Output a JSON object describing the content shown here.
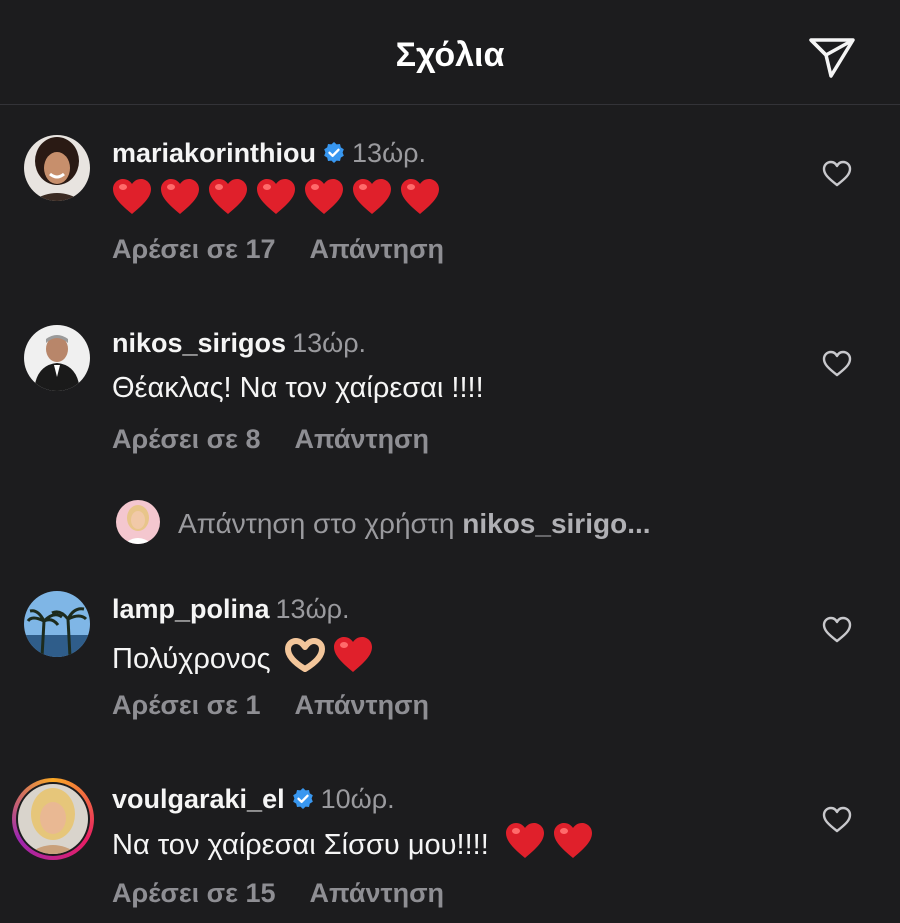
{
  "header": {
    "title": "Σχόλια",
    "share_icon": "paper-plane-icon"
  },
  "colors": {
    "background": "#1c1c1e",
    "verified": "#3897f0",
    "heart": "#e0202b",
    "muted": "#8e8e93"
  },
  "comments": [
    {
      "username": "mariakorinthiou",
      "verified": true,
      "time": "13ώρ.",
      "text": "",
      "emoji_hearts": 7,
      "likes_label": "Αρέσει σε 17",
      "reply_label": "Απάντηση"
    },
    {
      "username": "nikos_sirigos",
      "verified": false,
      "time": "13ώρ.",
      "text": "Θέακλας! Να τον χαίρεσαι !!!!",
      "likes_label": "Αρέσει σε 8",
      "reply_label": "Απάντηση"
    },
    {
      "username": "lamp_polina",
      "verified": false,
      "time": "13ώρ.",
      "text": "Πολύχρονος",
      "emoji": [
        "heart-hands-emoji",
        "red-heart-emoji"
      ],
      "likes_label": "Αρέσει σε 1",
      "reply_label": "Απάντηση"
    },
    {
      "username": "voulgaraki_el",
      "verified": true,
      "time": "10ώρ.",
      "text": "Να τον χαίρεσαι Σίσσυ μου!!!!",
      "emoji": [
        "red-heart-emoji",
        "red-heart-emoji"
      ],
      "likes_label": "Αρέσει σε 15",
      "reply_label": "Απάντηση"
    }
  ],
  "reply_composer": {
    "prefix": "Απάντηση στο χρήστη",
    "target": "nikos_sirigo..."
  }
}
